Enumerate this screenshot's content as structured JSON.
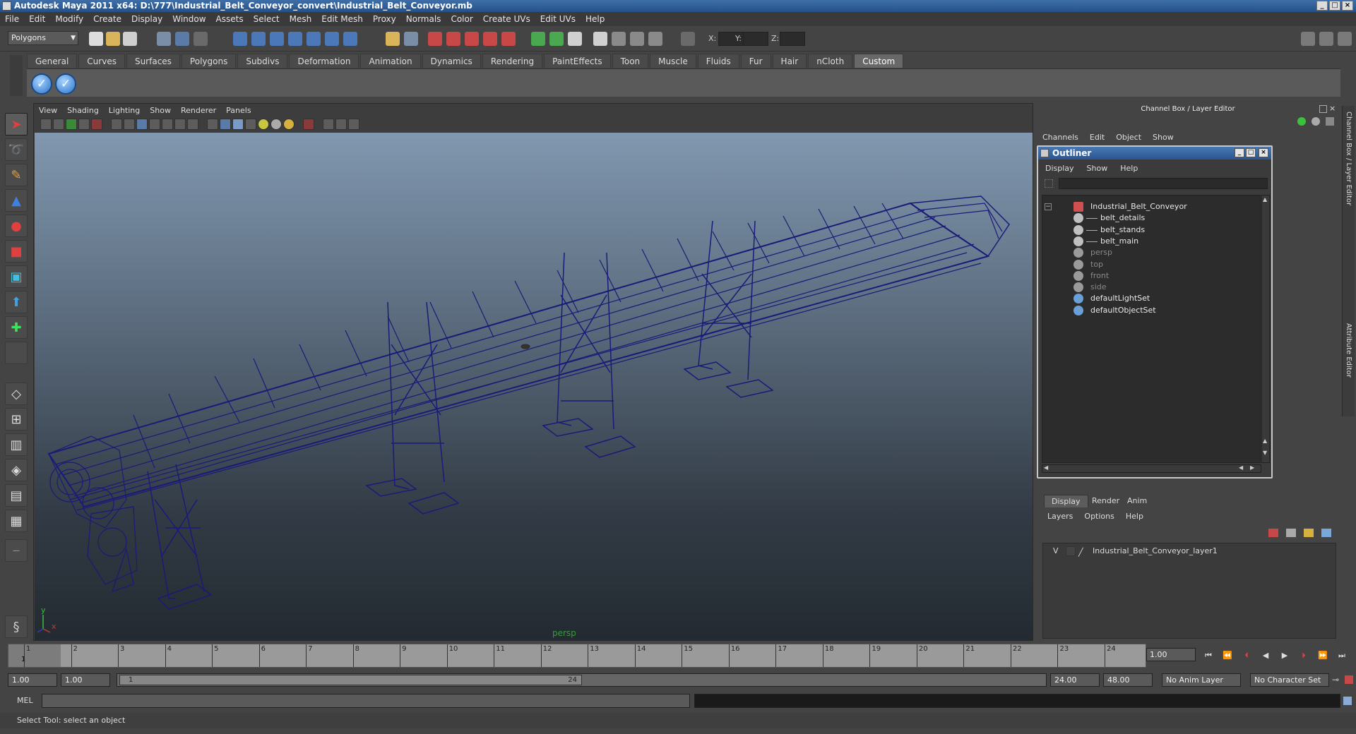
{
  "window": {
    "title": "Autodesk Maya 2011 x64: D:\\777\\Industrial_Belt_Conveyor_convert\\Industrial_Belt_Conveyor.mb"
  },
  "menubar": [
    "File",
    "Edit",
    "Modify",
    "Create",
    "Display",
    "Window",
    "Assets",
    "Select",
    "Mesh",
    "Edit Mesh",
    "Proxy",
    "Normals",
    "Color",
    "Create UVs",
    "Edit UVs",
    "Help"
  ],
  "statusline": {
    "menuset": "Polygons",
    "x_label": "X:",
    "y_label": "Y:",
    "z_label": "Z:"
  },
  "shelf": {
    "tabs": [
      "General",
      "Curves",
      "Surfaces",
      "Polygons",
      "Subdivs",
      "Deformation",
      "Animation",
      "Dynamics",
      "Rendering",
      "PaintEffects",
      "Toon",
      "Muscle",
      "Fluids",
      "Fur",
      "Hair",
      "nCloth",
      "Custom"
    ],
    "active_tab": "Custom"
  },
  "viewport": {
    "menu": [
      "View",
      "Shading",
      "Lighting",
      "Show",
      "Renderer",
      "Panels"
    ],
    "camera_label": "persp",
    "axis_y": "y",
    "axis_x": "x",
    "wire_color": "#1a1a78",
    "bg_top": "#8198b0",
    "bg_bottom": "#232a31"
  },
  "channelbox": {
    "title": "Channel Box / Layer Editor",
    "menu": [
      "Channels",
      "Edit",
      "Object",
      "Show"
    ],
    "side_tabs": [
      "Channel Box / Layer Editor",
      "Attribute Editor"
    ]
  },
  "outliner": {
    "title": "Outliner",
    "menu": [
      "Display",
      "Show",
      "Help"
    ],
    "items": [
      {
        "label": "Industrial_Belt_Conveyor",
        "icon": "transform-icon",
        "dim": false
      },
      {
        "label": "belt_details",
        "icon": "mesh-icon",
        "dim": false
      },
      {
        "label": "belt_stands",
        "icon": "mesh-icon",
        "dim": false
      },
      {
        "label": "belt_main",
        "icon": "mesh-icon",
        "dim": false
      },
      {
        "label": "persp",
        "icon": "camera-icon",
        "dim": true
      },
      {
        "label": "top",
        "icon": "camera-icon",
        "dim": true
      },
      {
        "label": "front",
        "icon": "camera-icon",
        "dim": true
      },
      {
        "label": "side",
        "icon": "camera-icon",
        "dim": true
      },
      {
        "label": "defaultLightSet",
        "icon": "set-icon",
        "dim": false
      },
      {
        "label": "defaultObjectSet",
        "icon": "set-icon",
        "dim": false
      }
    ]
  },
  "layers": {
    "tabs": [
      "Display",
      "Render",
      "Anim"
    ],
    "active_tab": "Display",
    "menu": [
      "Layers",
      "Options",
      "Help"
    ],
    "rows": [
      {
        "visible": "V",
        "name": "Industrial_Belt_Conveyor_layer1"
      }
    ]
  },
  "timeline": {
    "ticks": [
      "1",
      "2",
      "3",
      "4",
      "5",
      "6",
      "7",
      "8",
      "9",
      "10",
      "11",
      "12",
      "13",
      "14",
      "15",
      "16",
      "17",
      "18",
      "19",
      "20",
      "21",
      "22",
      "23",
      "24"
    ],
    "current_marker": "1",
    "current_frame": "1.00"
  },
  "range": {
    "start": "1.00",
    "playback_start": "1.00",
    "slider_start": "1",
    "slider_end": "24",
    "playback_end": "24.00",
    "end": "48.00",
    "anim_layer": "No Anim Layer",
    "character_set": "No Character Set"
  },
  "cmdline": {
    "label": "MEL"
  },
  "helpline": {
    "text": "Select Tool: select an object"
  }
}
